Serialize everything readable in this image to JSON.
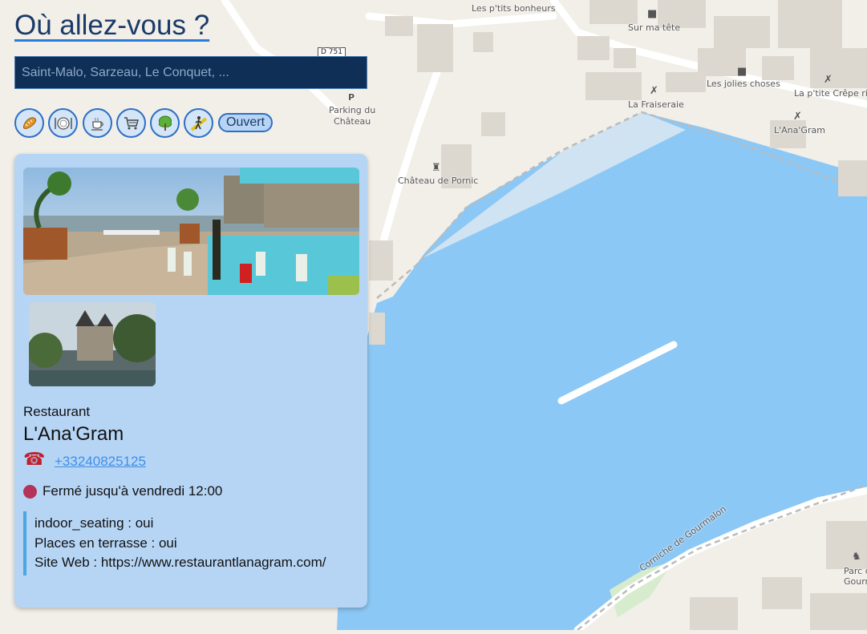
{
  "header": {
    "title": "Où allez-vous ?"
  },
  "search": {
    "placeholder": "Saint-Malo, Sarzeau, Le Conquet, ..."
  },
  "filters": {
    "items": [
      {
        "name": "bakery",
        "icon": "bread-icon"
      },
      {
        "name": "restaurant",
        "icon": "plate-icon"
      },
      {
        "name": "cafe",
        "icon": "coffee-cup-icon"
      },
      {
        "name": "shop",
        "icon": "shopping-cart-icon"
      },
      {
        "name": "park",
        "icon": "tree-icon"
      },
      {
        "name": "leisure",
        "icon": "hiker-icon"
      }
    ],
    "open_label": "Ouvert"
  },
  "map": {
    "labels": {
      "ptits_bonheurs": "Les p'tits bonheurs",
      "sur_ma_tete": "Sur ma tête",
      "jolies_choses": "Les jolies choses",
      "ptite_crepe": "La p'tite Crêpe rit",
      "d751": "D 751",
      "parking_line1": "Parking du",
      "parking_line2": "Château",
      "parking_p": "P",
      "fraiseraie": "La Fraiseraie",
      "anagram": "L'Ana'Gram",
      "chateau": "Château de Pornic",
      "corniche": "Corniche de Gourmalon",
      "parc_line1": "Parc d",
      "parc_line2": "Gourma"
    },
    "colors": {
      "water": "#8cc8f5",
      "land": "#f2efe9",
      "building": "#dcd8d0",
      "road": "#ffffff"
    }
  },
  "card": {
    "category": "Restaurant",
    "name": "L'Ana'Gram",
    "phone": "+33240825125",
    "status": "Fermé jusqu'à vendredi 12:00",
    "status_color": "#b43358",
    "tags": [
      "indoor_seating : oui",
      "Places en terrasse : oui",
      "Site Web : https://www.restaurantlanagram.com/"
    ]
  }
}
